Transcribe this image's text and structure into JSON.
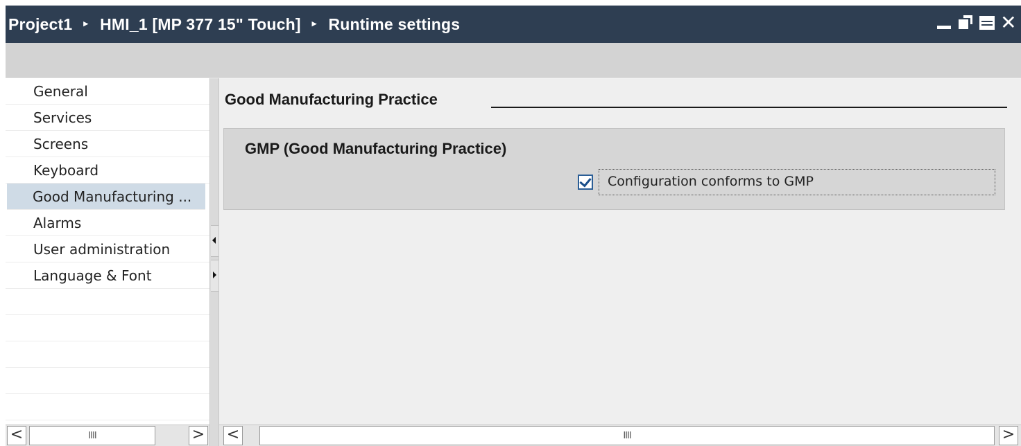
{
  "titlebar": {
    "crumbs": [
      "Project1",
      "HMI_1 [MP 377 15\" Touch]",
      "Runtime settings"
    ],
    "separator": "▸",
    "close_glyph": "✕"
  },
  "nav": {
    "items": [
      "General",
      "Services",
      "Screens",
      "Keyboard",
      "Good Manufacturing ...",
      "Alarms",
      "User administration",
      "Language & Font"
    ],
    "selected_index": 4
  },
  "main": {
    "section_title": "Good Manufacturing Practice",
    "group_title": "GMP (Good Manufacturing Practice)",
    "checkbox_label": "Configuration conforms to GMP",
    "checkbox_checked": true
  },
  "scrollbars": {
    "left_arrow": "<",
    "right_arrow": ">",
    "thumb_grip": "IIII"
  },
  "colors": {
    "titlebar": "#2e3e52",
    "selected": "#cfdbe6"
  }
}
